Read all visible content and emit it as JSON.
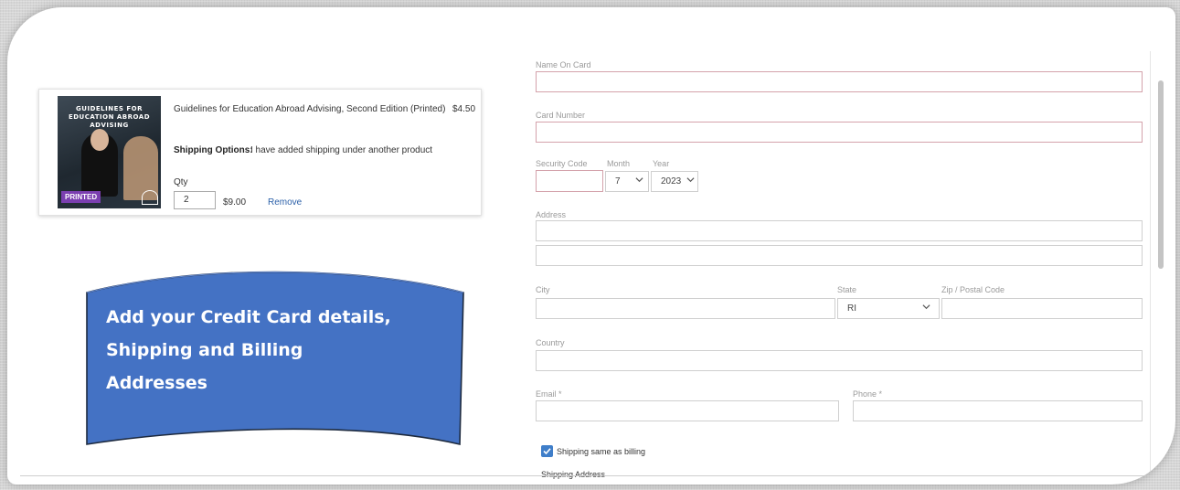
{
  "product": {
    "cover_title": "GUIDELINES FOR EDUCATION ABROAD ADVISING",
    "cover_badge": "PRINTED",
    "title": "Guidelines for Education Abroad Advising, Second Edition (Printed)",
    "price": "$4.50",
    "shipping_label": "Shipping Options:",
    "shipping_value": "I have added shipping under another product",
    "qty_label": "Qty",
    "qty_value": "2",
    "line_total": "$9.00",
    "remove_label": "Remove"
  },
  "callout": {
    "text_line1": "Add your Credit Card details,",
    "text_line2": "Shipping and Billing",
    "text_line3": "Addresses",
    "color": "#4472c4"
  },
  "form": {
    "name_on_card_label": "Name On Card",
    "card_number_label": "Card Number",
    "security_code_label": "Security Code",
    "month_label": "Month",
    "month_value": "7",
    "year_label": "Year",
    "year_value": "2023",
    "address_label": "Address",
    "city_label": "City",
    "state_label": "State",
    "state_value": "RI",
    "zip_label": "Zip / Postal Code",
    "country_label": "Country",
    "email_label": "Email *",
    "phone_label": "Phone *",
    "shipping_same_label": "Shipping same as billing",
    "shipping_same_checked": true,
    "shipping_address_label": "Shipping Address"
  },
  "colors": {
    "error_border": "#d4a2ab",
    "checkbox": "#3f7ec9",
    "link": "#2a5fa8"
  }
}
